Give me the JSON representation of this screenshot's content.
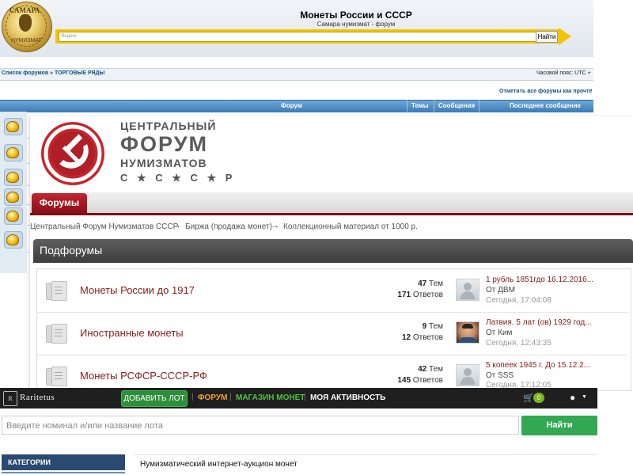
{
  "samara": {
    "logo_top": "САМАРА",
    "logo_bottom": "НУМИЗМАТ",
    "title": "Монеты России и СССР",
    "subtitle": "Самара нумизмат - форум",
    "search_placeholder": "Яндекс",
    "search_button": "Найти",
    "breadcrumb": "Список форумов » ТОРГОВЫЕ РЯДЫ",
    "timezone": "Часовой пояс: UTC + ",
    "mark_all": "Отметить все форумы как прочтё",
    "columns": [
      "Форум",
      "Темы",
      "Сообщения",
      "Последнее сообщение"
    ]
  },
  "cfn": {
    "brand": [
      "ЦЕНТРАЛЬНЫЙ",
      "ФОРУМ",
      "НУМИЗМАТОВ",
      "С ★ С ★ С ★ Р"
    ],
    "tab": "Форумы",
    "breadcrumb": [
      "Центральный Форум Нумизматов СССР",
      "Биржа (продажа монет)",
      "Коллекционный материал от 1000 р."
    ],
    "subforums_title": "Подфорумы",
    "forums": [
      {
        "name": "Монеты России до 1917",
        "topics": "47",
        "topics_label": "Тем",
        "posts": "171",
        "posts_label": "Ответов",
        "last_title": "1 рубль 1851гдо 16.12.2016...",
        "last_by": "От ДВМ",
        "last_time": "Сегодня, 17:04:08"
      },
      {
        "name": "Иностранные монеты",
        "topics": "9",
        "topics_label": "Тем",
        "posts": "12",
        "posts_label": "Ответов",
        "last_title": "Латвия. 5 лат (ов) 1929 год...",
        "last_by": "От Ким",
        "last_time": "Сегодня, 12:43:35"
      },
      {
        "name": "Монеты РСФСР-СССР-РФ",
        "topics": "42",
        "topics_label": "Тем",
        "posts": "145",
        "posts_label": "Ответов",
        "last_title": "5 копеек 1945 г. До 15.12.2...",
        "last_by": "От SSS",
        "last_time": "Сегодня, 17:12:05"
      }
    ]
  },
  "raritetus": {
    "logo_mark": "R",
    "logo_name": "Raritetus",
    "add_lot": "ДОБАВИТЬ ЛОТ",
    "nav": [
      "ФОРУМ",
      "МАГАЗИН МОНЕТ",
      "МОЯ АКТИВНОСТЬ"
    ],
    "cart_count": "0",
    "search_placeholder": "Введите номинал и/или название лота",
    "search_button": "Найти",
    "categories": "КАТЕГОРИИ",
    "slogan": "Нумизматический интернет-аукцион монет",
    "colors": {
      "forum": "#f2a62b",
      "shop": "#4fc242",
      "activity": "#ffffff"
    }
  }
}
